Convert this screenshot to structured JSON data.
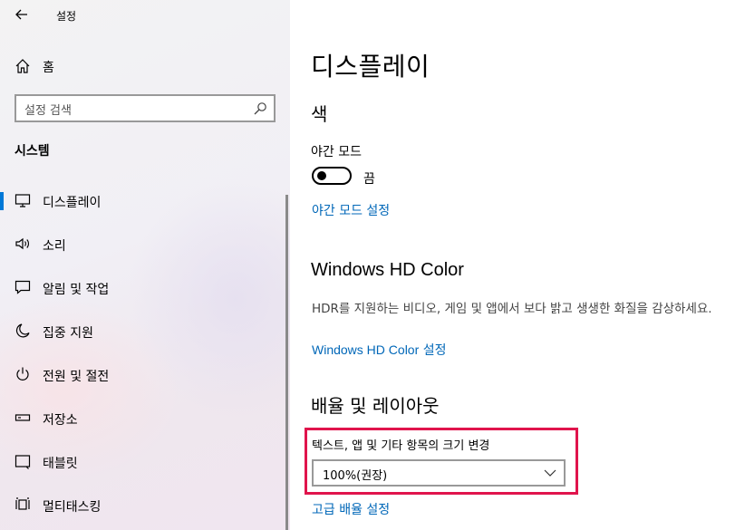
{
  "app": {
    "title": "설정"
  },
  "sidebar": {
    "home_label": "홈",
    "search": {
      "placeholder": "설정 검색"
    },
    "section_title": "시스템",
    "items": [
      {
        "label": "디스플레이",
        "icon": "monitor-icon",
        "active": true
      },
      {
        "label": "소리",
        "icon": "speaker-icon",
        "active": false
      },
      {
        "label": "알림 및 작업",
        "icon": "notification-icon",
        "active": false
      },
      {
        "label": "집중 지원",
        "icon": "moon-icon",
        "active": false
      },
      {
        "label": "전원 및 절전",
        "icon": "power-icon",
        "active": false
      },
      {
        "label": "저장소",
        "icon": "storage-icon",
        "active": false
      },
      {
        "label": "태블릿",
        "icon": "tablet-icon",
        "active": false
      },
      {
        "label": "멀티태스킹",
        "icon": "multitasking-icon",
        "active": false
      }
    ]
  },
  "main": {
    "page_title": "디스플레이",
    "color_section": {
      "heading": "색",
      "night_light_label": "야간 모드",
      "toggle_state": "끔",
      "night_light_settings_link": "야간 모드 설정"
    },
    "hd_color_section": {
      "heading": "Windows HD Color",
      "description": "HDR를 지원하는 비디오, 게임 및 앱에서 보다 밝고 생생한 화질을 감상하세요.",
      "link_en": "Windows HD Color",
      "link_ko": " 설정"
    },
    "scale_section": {
      "heading": "배율 및 레이아웃",
      "scale_label": "텍스트, 앱 및 기타 항목의 크기 변경",
      "scale_value": "100%(권장)",
      "advanced_link": "고급 배율 설정"
    }
  },
  "colors": {
    "accent": "#0078d7",
    "link": "#0067b8",
    "highlight_border": "#e0144c"
  }
}
